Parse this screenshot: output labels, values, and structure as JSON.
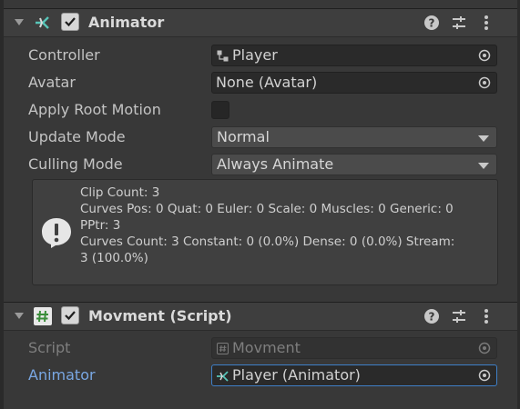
{
  "animator": {
    "title": "Animator",
    "props": {
      "controller": {
        "label": "Controller",
        "value": "Player"
      },
      "avatar": {
        "label": "Avatar",
        "value": "None (Avatar)"
      },
      "apply_root_motion": {
        "label": "Apply Root Motion",
        "checked": false
      },
      "update_mode": {
        "label": "Update Mode",
        "value": "Normal"
      },
      "culling_mode": {
        "label": "Culling Mode",
        "value": "Always Animate"
      }
    },
    "info": {
      "text": "Clip Count: 3\nCurves Pos: 0 Quat: 0 Euler: 0 Scale: 0 Muscles: 0 Generic: 0\nPPtr: 3\nCurves Count: 3 Constant: 0 (0.0%) Dense: 0 (0.0%) Stream:\n3 (100.0%)"
    }
  },
  "movment": {
    "title": "Movment (Script)",
    "props": {
      "script": {
        "label": "Script",
        "value": "Movment"
      },
      "animator": {
        "label": "Animator",
        "value": "Player (Animator)"
      }
    }
  },
  "icons": [
    "foldout-arrow",
    "animator-icon",
    "checkbox-check",
    "help-icon",
    "preset-icon",
    "kebab-menu-icon",
    "controller-icon",
    "object-picker-icon",
    "dropdown-arrow-icon",
    "info-bubble-icon",
    "script-hash-icon"
  ],
  "colors": {
    "background": "#383838",
    "header": "#3e3e3e",
    "link_label": "#79a7e3",
    "focus_border": "#3f7fc7"
  }
}
